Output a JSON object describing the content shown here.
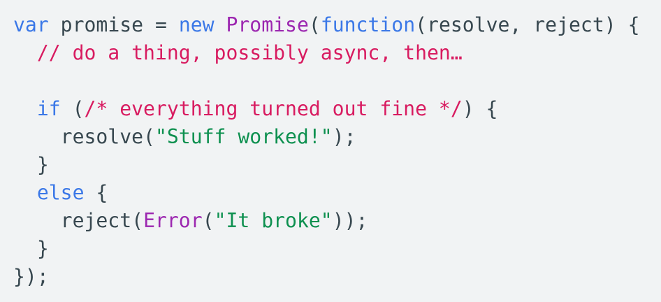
{
  "code": {
    "lines": [
      [
        {
          "t": "var",
          "c": "kw"
        },
        {
          "t": " promise = ",
          "c": "pl"
        },
        {
          "t": "new",
          "c": "kw"
        },
        {
          "t": " ",
          "c": "pl"
        },
        {
          "t": "Promise",
          "c": "cls"
        },
        {
          "t": "(",
          "c": "pl"
        },
        {
          "t": "function",
          "c": "kw"
        },
        {
          "t": "(resolve, reject) {",
          "c": "pl"
        }
      ],
      [
        {
          "t": "  ",
          "c": "pl"
        },
        {
          "t": "// do a thing, possibly async, then…",
          "c": "cm"
        }
      ],
      [],
      [
        {
          "t": "  ",
          "c": "pl"
        },
        {
          "t": "if",
          "c": "kw"
        },
        {
          "t": " (",
          "c": "pl"
        },
        {
          "t": "/* everything turned out fine */",
          "c": "cm"
        },
        {
          "t": ") {",
          "c": "pl"
        }
      ],
      [
        {
          "t": "    resolve(",
          "c": "pl"
        },
        {
          "t": "\"Stuff worked!\"",
          "c": "str"
        },
        {
          "t": ");",
          "c": "pl"
        }
      ],
      [
        {
          "t": "  }",
          "c": "pl"
        }
      ],
      [
        {
          "t": "  ",
          "c": "pl"
        },
        {
          "t": "else",
          "c": "kw"
        },
        {
          "t": " {",
          "c": "pl"
        }
      ],
      [
        {
          "t": "    reject(",
          "c": "pl"
        },
        {
          "t": "Error",
          "c": "cls"
        },
        {
          "t": "(",
          "c": "pl"
        },
        {
          "t": "\"It broke\"",
          "c": "str"
        },
        {
          "t": "));",
          "c": "pl"
        }
      ],
      [
        {
          "t": "  }",
          "c": "pl"
        }
      ],
      [
        {
          "t": "});",
          "c": "pl"
        }
      ]
    ],
    "colors": {
      "background": "#f1f3f4",
      "keyword": "#3b78e7",
      "class": "#9c27b0",
      "comment": "#d81b60",
      "string": "#0d904f",
      "plain": "#37474f"
    }
  }
}
